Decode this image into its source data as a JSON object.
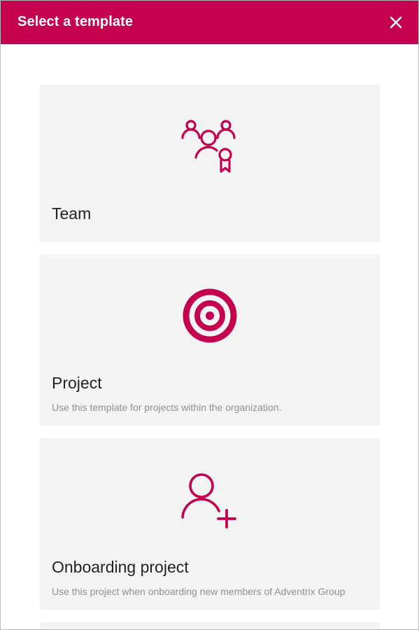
{
  "dialog": {
    "title": "Select a template",
    "close_icon": "close-icon"
  },
  "templates": [
    {
      "title": "Team",
      "description": "",
      "icon": "team-icon"
    },
    {
      "title": "Project",
      "description": "Use this template for projects within the organization.",
      "icon": "target-icon"
    },
    {
      "title": "Onboarding project",
      "description": "Use this project when onboarding new members of Adventrix Group",
      "icon": "add-user-icon"
    }
  ],
  "colors": {
    "accent": "#c4004f",
    "card_background": "#f3f3f3",
    "title_text": "#222222",
    "description_text": "#8f8f8f"
  }
}
